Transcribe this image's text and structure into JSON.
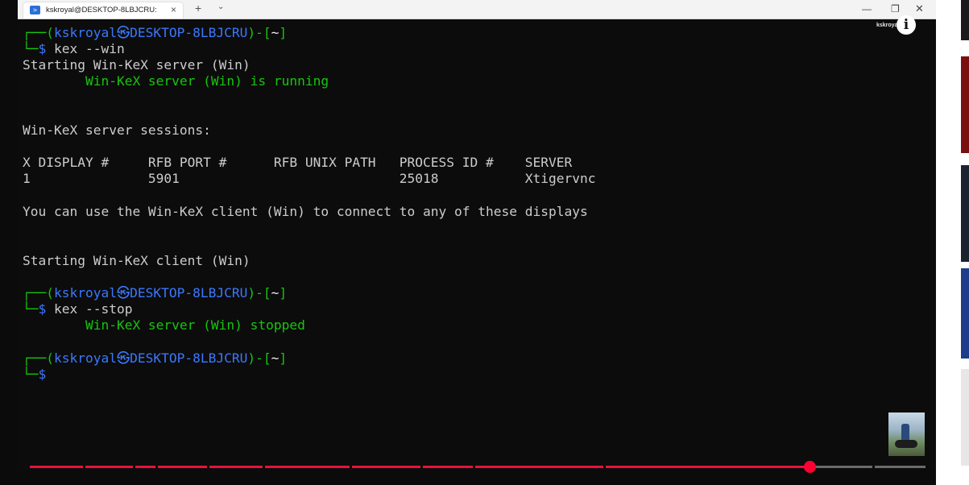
{
  "window": {
    "tab_title": "kskroyal@DESKTOP-8LBJCRU:",
    "tab_icon_glyph": ">",
    "close_glyph": "×",
    "new_tab_glyph": "+",
    "dropdown_glyph": "⌄",
    "minimize_glyph": "—",
    "maximize_glyph": "❐",
    "window_close_glyph": "✕"
  },
  "terminal": {
    "prompt": {
      "box_top": "┌──(",
      "user_host": "kskroyal㉿DESKTOP-8LBJCRU",
      "mid": ")-[",
      "cwd": "~",
      "end": "]",
      "box_bottom": "└─",
      "dollar": "$"
    },
    "cmd1": " kex --win",
    "start_server": "Starting Win-KeX server (Win)",
    "server_running": "        Win-KeX server (Win) is running",
    "sessions_header": "Win-KeX server sessions:",
    "table_header": "X DISPLAY #     RFB PORT #      RFB UNIX PATH   PROCESS ID #    SERVER",
    "table_row": "1               5901                            25018           Xtigervnc",
    "hint": "You can use the Win-KeX client (Win) to connect to any of these displays",
    "start_client": "Starting Win-KeX client (Win)",
    "cmd2": " kex --stop",
    "server_stopped": "        Win-KeX server (Win) stopped"
  },
  "player": {
    "watermark": "kskroyal",
    "info_glyph": "i",
    "progress_fraction": 0.866
  },
  "colors": {
    "prompt_box": "#16c60c",
    "prompt_user": "#3b78ff",
    "progress": "#e8123b",
    "scrubber": "#ff0033"
  }
}
